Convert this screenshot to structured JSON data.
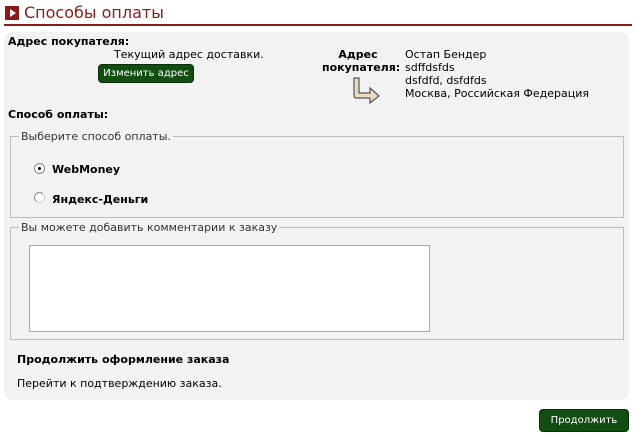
{
  "page": {
    "title": "Способы оплаты"
  },
  "buyer_address": {
    "section_title": "Адрес покупателя:",
    "current_delivery_text": "Текущий адрес доставки.",
    "change_address_button": "Изменить адрес",
    "label_line1": "Адрес",
    "label_line2": "покупателя:",
    "lines": [
      "Остап Бендер",
      "sdffdsfds",
      "dsfdfd, dsfdfds",
      "Москва, Российская Федерация"
    ]
  },
  "payment": {
    "section_title": "Способ оплаты:",
    "legend": "Выберите способ оплаты.",
    "options": [
      {
        "label": "WebMoney",
        "checked": true
      },
      {
        "label": "Яндекс-Деньги",
        "checked": false
      }
    ]
  },
  "comments": {
    "legend": "Вы можете добавить комментарии к заказу",
    "value": ""
  },
  "continue_section": {
    "title": "Продолжить оформление заказа",
    "text": "Перейти к подтверждению заказа."
  },
  "continue_button": "Продолжить",
  "colors": {
    "brand": "#8b1a1a",
    "button": "#124d12",
    "panel": "#f2f2f2"
  }
}
